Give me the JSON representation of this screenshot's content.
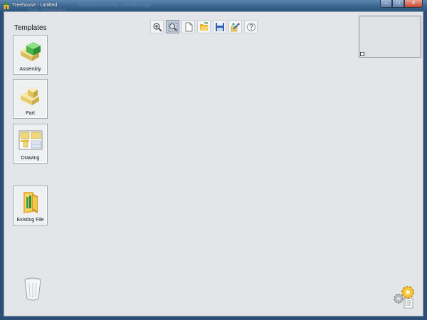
{
  "window": {
    "title": "Treehouse - Untitled",
    "ghost_title_1": "Treehouse Assembly - Untitled Design",
    "ghost_title_2": "Tree - Untitled Desc",
    "buttons": {
      "minimize": "–",
      "maximize": "□",
      "close": "✕"
    }
  },
  "templates": {
    "heading": "Templates",
    "items": [
      {
        "label": "Assembly",
        "icon": "assembly-icon"
      },
      {
        "label": "Part",
        "icon": "part-icon"
      },
      {
        "label": "Drawing",
        "icon": "drawing-icon"
      },
      {
        "label": "Existing File",
        "icon": "open-folder-icon"
      }
    ]
  },
  "toolbar": {
    "buttons": [
      {
        "icon": "zoom-in-icon",
        "active": false
      },
      {
        "icon": "zoom-fit-icon",
        "active": true
      },
      {
        "icon": "new-document-icon",
        "active": false
      },
      {
        "icon": "open-folder-icon",
        "active": false
      },
      {
        "icon": "save-icon",
        "active": false
      },
      {
        "icon": "edit-properties-icon",
        "active": false
      },
      {
        "icon": "help-icon",
        "active": false
      }
    ]
  },
  "colors": {
    "titlebar": "#3b6590",
    "client_background": "#e3e5e8",
    "assembly_green": "#49b84a",
    "part_yellow": "#e6cf6a",
    "save_blue": "#2f5fb3",
    "folder_yellow": "#f3c94a"
  }
}
